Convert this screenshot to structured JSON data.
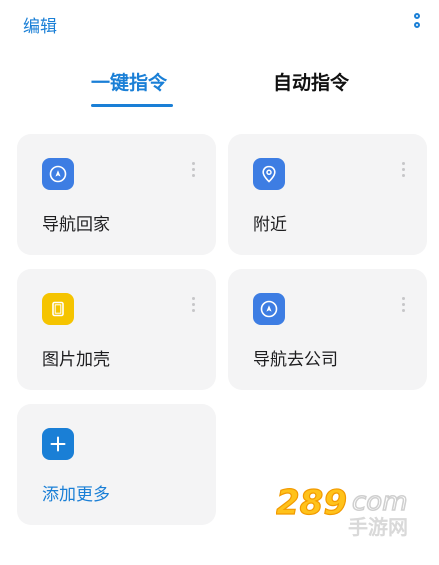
{
  "header": {
    "edit_label": "编辑",
    "more_icon": "more-vertical-icon"
  },
  "tabs": [
    {
      "label": "一键指令",
      "active": true
    },
    {
      "label": "自动指令",
      "active": false
    }
  ],
  "cards": [
    {
      "label": "导航回家",
      "icon": "navigation-icon",
      "icon_color": "#3d7de3"
    },
    {
      "label": "附近",
      "icon": "location-pin-icon",
      "icon_color": "#3d7de3"
    },
    {
      "label": "图片加壳",
      "icon": "image-frame-icon",
      "icon_color": "#f5c400"
    },
    {
      "label": "导航去公司",
      "icon": "navigation-icon",
      "icon_color": "#3d7de3"
    }
  ],
  "add_card": {
    "label": "添加更多",
    "icon": "plus-icon",
    "icon_color": "#1a7fd6"
  },
  "colors": {
    "accent": "#1a7fd6",
    "card_bg": "#f4f4f5"
  },
  "watermark": {
    "number": "289",
    "domain": "com",
    "text": "手游网"
  }
}
